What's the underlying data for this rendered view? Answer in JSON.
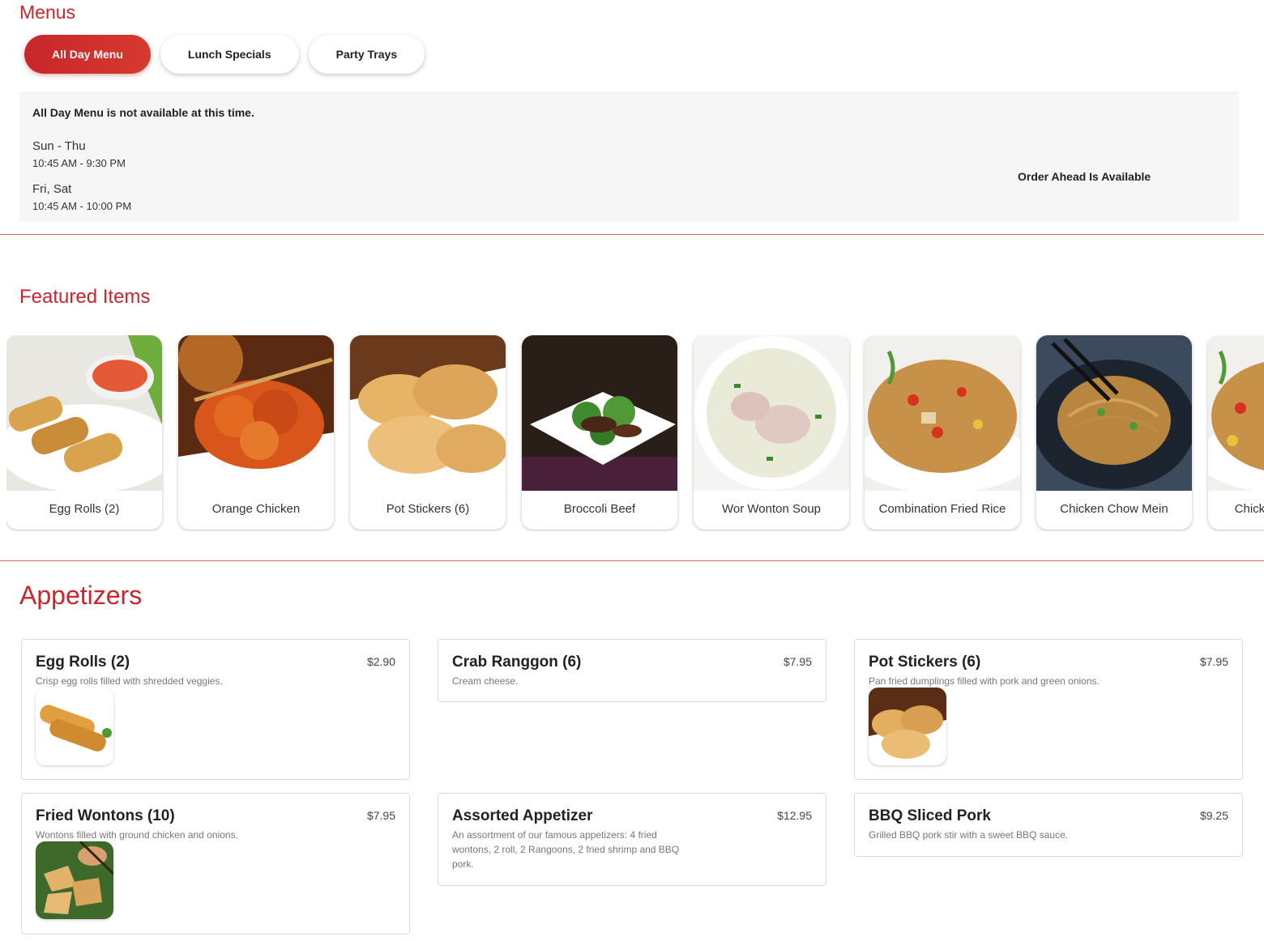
{
  "menus": {
    "title": "Menus",
    "tabs": [
      {
        "label": "All Day Menu",
        "active": true
      },
      {
        "label": "Lunch Specials",
        "active": false
      },
      {
        "label": "Party Trays",
        "active": false
      }
    ]
  },
  "availability": {
    "notice": "All Day Menu is not available at this time.",
    "hours": [
      {
        "days": "Sun - Thu",
        "time": "10:45 AM - 9:30 PM"
      },
      {
        "days": "Fri, Sat",
        "time": "10:45 AM - 10:00 PM"
      }
    ],
    "order_ahead": "Order Ahead Is Available"
  },
  "featured": {
    "title": "Featured Items",
    "items": [
      {
        "name": "Egg Rolls (2)"
      },
      {
        "name": "Orange Chicken"
      },
      {
        "name": "Pot Stickers (6)"
      },
      {
        "name": "Broccoli Beef"
      },
      {
        "name": "Wor Wonton Soup"
      },
      {
        "name": "Combination Fried Rice"
      },
      {
        "name": "Chicken Chow Mein"
      },
      {
        "name": "Chicken Fried Rice"
      }
    ]
  },
  "appetizers": {
    "title": "Appetizers",
    "items": [
      {
        "name": "Egg Rolls (2)",
        "price": "$2.90",
        "description": "Crisp egg rolls filled with shredded veggies."
      },
      {
        "name": "Crab Ranggon (6)",
        "price": "$7.95",
        "description": "Cream cheese."
      },
      {
        "name": "Pot Stickers (6)",
        "price": "$7.95",
        "description": "Pan fried dumplings filled with pork and green onions."
      },
      {
        "name": "Fried Wontons (10)",
        "price": "$7.95",
        "description": "Wontons filled with ground chicken and onions."
      },
      {
        "name": "Assorted Appetizer",
        "price": "$12.95",
        "description": "An assortment of our famous appetizers: 4 fried wontons, 2 roll, 2 Rangoons, 2 fried shrimp and BBQ pork."
      },
      {
        "name": "BBQ Sliced Pork",
        "price": "$9.25",
        "description": "Grilled BBQ pork stir with a sweet BBQ sauce."
      }
    ]
  }
}
